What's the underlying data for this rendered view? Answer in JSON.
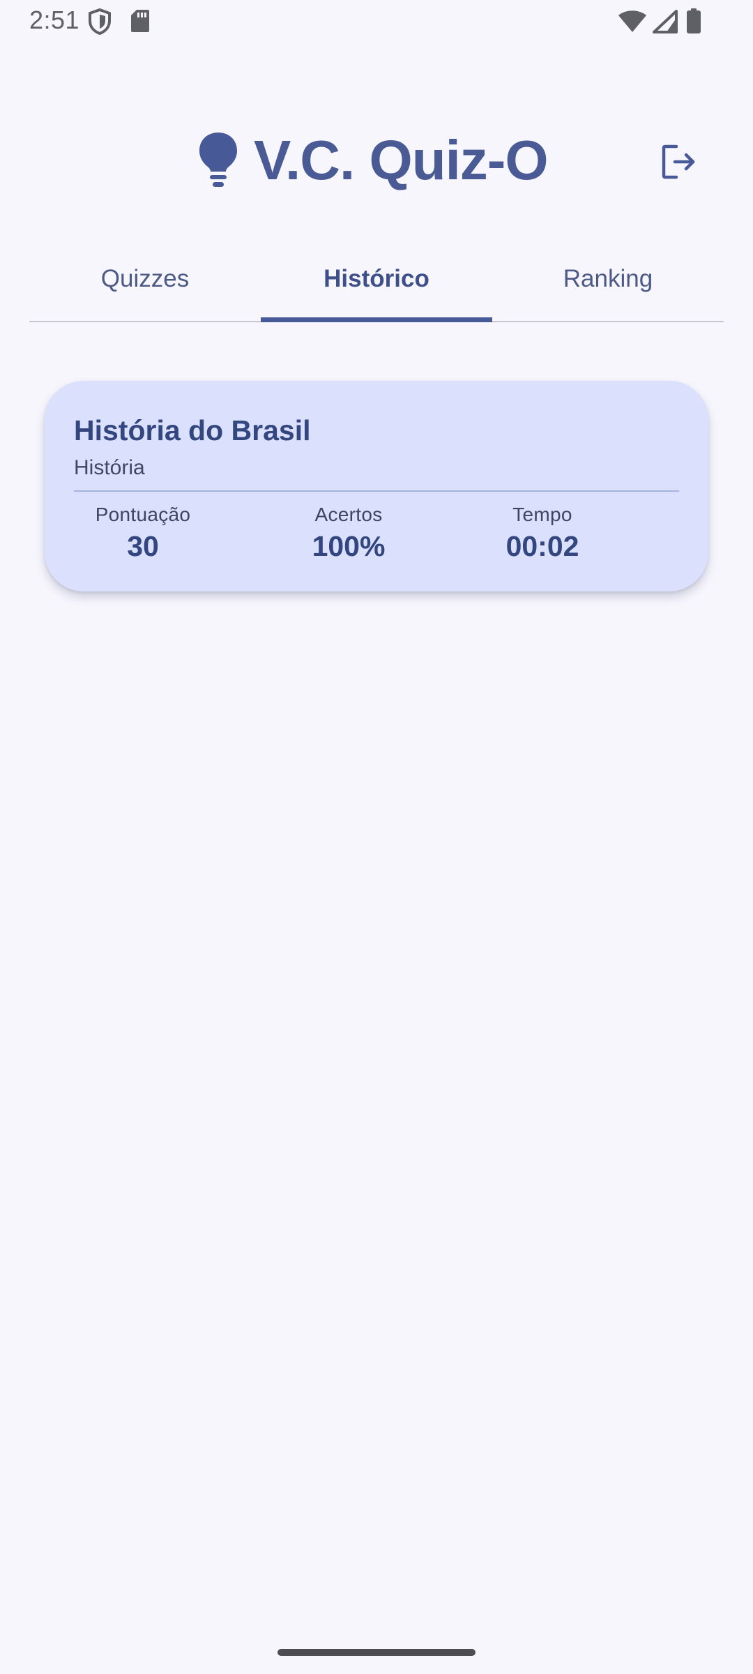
{
  "status_bar": {
    "time": "2:51",
    "icons": [
      "shield-icon",
      "sdcard-icon",
      "wifi-icon",
      "signal-icon",
      "battery-icon"
    ]
  },
  "header": {
    "title": "V.C. Quiz-O",
    "logo_icon": "lightbulb-icon",
    "logout_icon": "logout-icon"
  },
  "tabs": [
    {
      "label": "Quizzes",
      "active": false
    },
    {
      "label": "Histórico",
      "active": true
    },
    {
      "label": "Ranking",
      "active": false
    }
  ],
  "history": [
    {
      "title": "História do Brasil",
      "category": "História",
      "stats": {
        "score_label": "Pontuação",
        "score_value": "30",
        "correct_label": "Acertos",
        "correct_value": "100%",
        "time_label": "Tempo",
        "time_value": "00:02"
      }
    }
  ],
  "colors": {
    "primary": "#475a97",
    "background": "#f7f6fd",
    "card": "#dbe1fc",
    "title_text": "#334680"
  }
}
